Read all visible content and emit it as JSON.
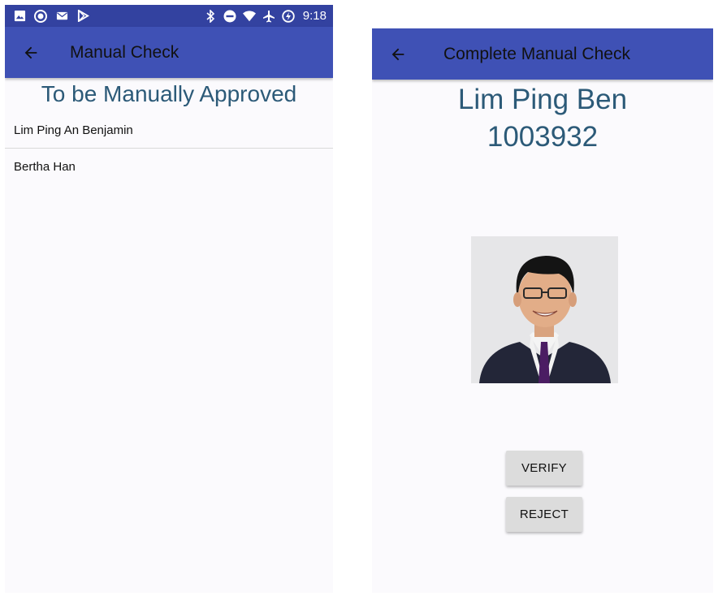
{
  "left_screen": {
    "status_bar": {
      "left_icons": [
        "image-icon",
        "app-badge-icon",
        "mail-icon",
        "play-store-icon"
      ],
      "right_icons": [
        "bluetooth-icon",
        "do-not-disturb-icon",
        "wifi-icon",
        "airplane-icon",
        "battery-charging-icon"
      ],
      "time": "9:18",
      "color": "#3342a0"
    },
    "app_bar": {
      "title": "Manual Check",
      "color": "#3f51b5"
    },
    "heading": "To be Manually Approved",
    "list_items": [
      {
        "label": "Lim Ping An Benjamin"
      },
      {
        "label": "Bertha Han"
      }
    ]
  },
  "right_screen": {
    "app_bar": {
      "title": "Complete Manual Check",
      "color": "#3f51b5"
    },
    "name": "Lim Ping Ben",
    "id_number": "1003932",
    "buttons": {
      "verify": "VERIFY",
      "reject": "REJECT"
    }
  },
  "colors": {
    "heading_text": "#2c5a78",
    "screen_background": "#fbfafd",
    "button_background": "#dcdcdc"
  }
}
